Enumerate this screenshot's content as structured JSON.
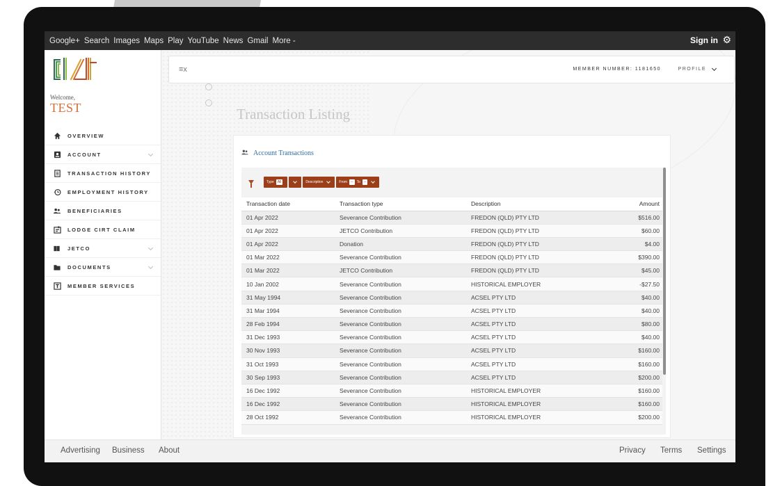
{
  "gbar": {
    "links": [
      "Google+",
      "Search",
      "Images",
      "Maps",
      "Play",
      "YouTube",
      "News",
      "Gmail",
      "More -"
    ],
    "signin": "Sign in",
    "gear": "⚙"
  },
  "sidebar": {
    "welcome": "Welcome,",
    "user": "TEST",
    "items": [
      {
        "label": "OVERVIEW",
        "icon": "home-icon"
      },
      {
        "label": "ACCOUNT",
        "icon": "account-icon"
      },
      {
        "label": "TRANSACTION HISTORY",
        "icon": "receipt-icon"
      },
      {
        "label": "EMPLOYMENT HISTORY",
        "icon": "history-icon"
      },
      {
        "label": "BENEFICIARIES",
        "icon": "people-icon"
      },
      {
        "label": "LODGE CIRT CLAIM",
        "icon": "claim-icon"
      },
      {
        "label": "JETCO",
        "icon": "book-icon"
      },
      {
        "label": "DOCUMENTS",
        "icon": "folder-icon"
      },
      {
        "label": "MEMBER SERVICES",
        "icon": "services-icon"
      }
    ]
  },
  "topbar": {
    "menu_icon": "≡x",
    "member_number": "MEMBER NUMBER: 1181650",
    "profile": "PROFILE"
  },
  "page": {
    "title": "Transaction Listing",
    "card_title": "Account Transactions"
  },
  "filters": {
    "type_label": "Type",
    "type_value": "All",
    "description_label": "Description",
    "from_label": "From",
    "to_label": "To"
  },
  "table": {
    "headers": [
      "Transaction date",
      "Transaction type",
      "Description",
      "Amount"
    ],
    "rows": [
      [
        "01 Apr 2022",
        "Severance Contribution",
        "FREDON (QLD) PTY LTD",
        "$516.00"
      ],
      [
        "01 Apr 2022",
        "JETCO Contribution",
        "FREDON (QLD) PTY LTD",
        "$60.00"
      ],
      [
        "01 Apr 2022",
        "Donation",
        "FREDON (QLD) PTY LTD",
        "$4.00"
      ],
      [
        "01 Mar 2022",
        "Severance Contribution",
        "FREDON (QLD) PTY LTD",
        "$390.00"
      ],
      [
        "01 Mar 2022",
        "JETCO Contribution",
        "FREDON (QLD) PTY LTD",
        "$45.00"
      ],
      [
        "10 Jan 2002",
        "Severance Contribution",
        "HISTORICAL EMPLOYER",
        "-$27.50"
      ],
      [
        "31 May 1994",
        "Severance Contribution",
        "ACSEL PTY LTD",
        "$40.00"
      ],
      [
        "31 Mar 1994",
        "Severance Contribution",
        "ACSEL PTY LTD",
        "$40.00"
      ],
      [
        "28 Feb 1994",
        "Severance Contribution",
        "ACSEL PTY LTD",
        "$80.00"
      ],
      [
        "31 Dec 1993",
        "Severance Contribution",
        "ACSEL PTY LTD",
        "$40.00"
      ],
      [
        "30 Nov 1993",
        "Severance Contribution",
        "ACSEL PTY LTD",
        "$160.00"
      ],
      [
        "31 Oct 1993",
        "Severance Contribution",
        "ACSEL PTY LTD",
        "$160.00"
      ],
      [
        "30 Sep 1993",
        "Severance Contribution",
        "ACSEL PTY LTD",
        "$200.00"
      ],
      [
        "16 Dec 1992",
        "Severance Contribution",
        "HISTORICAL EMPLOYER",
        "$160.00"
      ],
      [
        "16 Dec 1992",
        "Severance Contribution",
        "HISTORICAL EMPLOYER",
        "$160.00"
      ],
      [
        "28 Oct 1992",
        "Severance Contribution",
        "HISTORICAL EMPLOYER",
        "$200.00"
      ]
    ]
  },
  "footer": {
    "advertising": "Advertising",
    "business": "Business",
    "about": "About",
    "privacy": "Privacy",
    "terms": "Terms",
    "settings": "Settings"
  },
  "colors": {
    "accent": "#d66e35",
    "filter": "#9c3e1a",
    "link": "#2e6da4"
  }
}
